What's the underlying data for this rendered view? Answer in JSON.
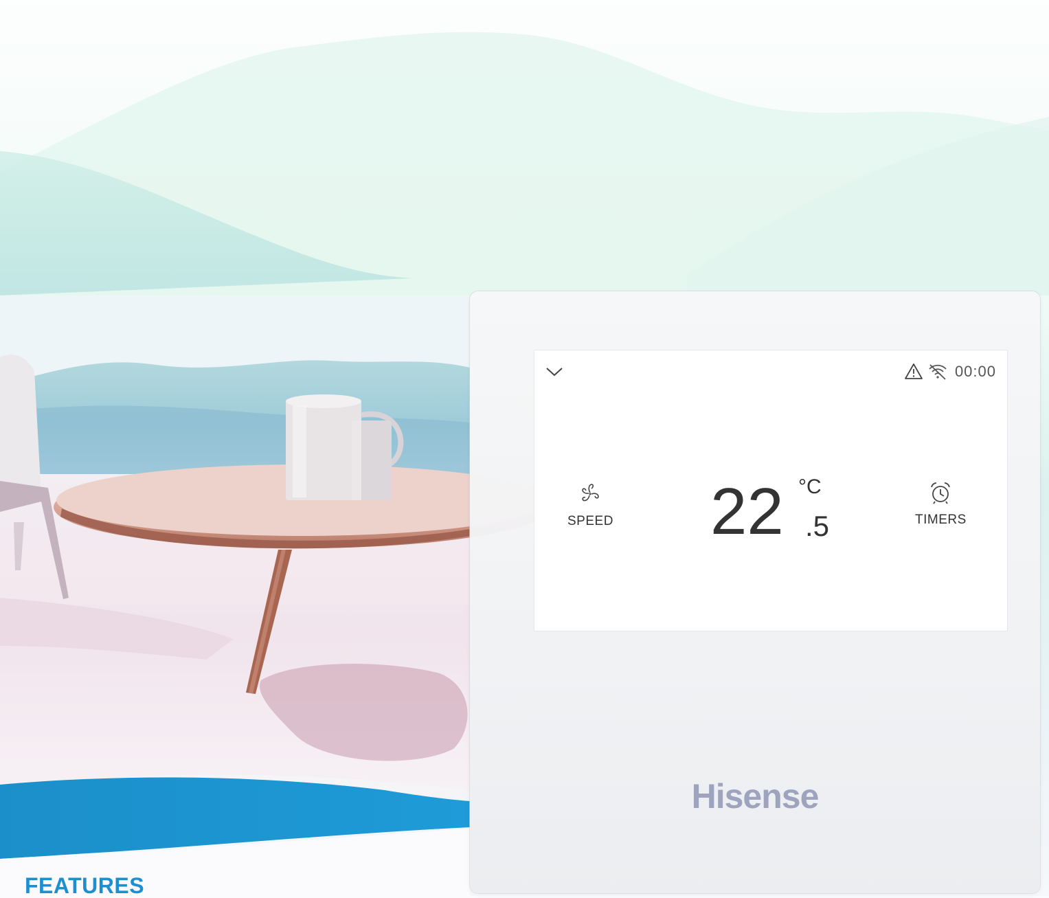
{
  "screen": {
    "status_time": "00:00",
    "speed_label": "SPEED",
    "timers_label": "TIMERS",
    "temperature_whole": "22",
    "temperature_decimal": ".5",
    "temperature_unit": "°C"
  },
  "brand": "Hisense",
  "section_heading": "FEATURES",
  "colors": {
    "accent_blue": "#1d8fcf",
    "brand_gray": "#9ea4bd"
  },
  "icons": [
    "chevron-down-icon",
    "warning-icon",
    "wifi-off-icon",
    "fan-icon",
    "alarm-clock-icon"
  ]
}
